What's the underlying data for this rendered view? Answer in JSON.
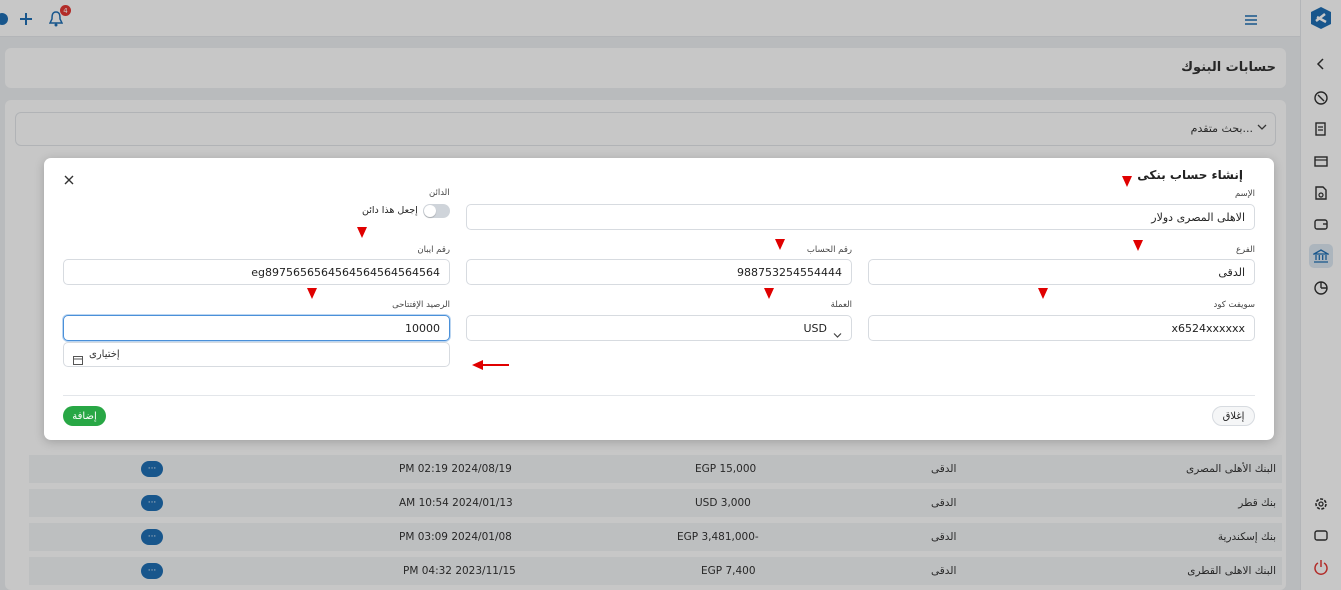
{
  "topbar": {
    "notification_count": "4"
  },
  "page": {
    "title": "حسابات البنوك"
  },
  "advanced_search": {
    "label": "بحث متقدم..."
  },
  "table": {
    "rows": [
      {
        "bank": "البنك الأهلى المصرى",
        "branch": "الدقى",
        "balance": "EGP 15,000",
        "date": "PM 02:19 2024/08/19",
        "action": "···"
      },
      {
        "bank": "بنك قطر",
        "branch": "الدقى",
        "balance": "USD 3,000",
        "date": "AM 10:54 2024/01/13",
        "action": "···"
      },
      {
        "bank": "بنك إسكندرية",
        "branch": "الدقى",
        "balance": "EGP 3,481,000-",
        "date": "PM 03:09 2024/01/08",
        "action": "···"
      },
      {
        "bank": "البنك الاهلى القطرى",
        "branch": "الدقى",
        "balance": "EGP 7,400",
        "date": "PM 04:32 2023/11/15",
        "action": "···"
      }
    ]
  },
  "modal": {
    "title": "إنشاء حساب بنكى",
    "name_label": "الإسم",
    "name_value": "الاهلى المصرى دولار",
    "creditor_label": "الدائن",
    "toggle_label": "إجعل هذا دائن",
    "branch_label": "الفرع",
    "branch_value": "الدقى",
    "account_label": "رقم الحساب",
    "account_value": "988753254554444",
    "iban_label": "رقم ايبان",
    "iban_value": "eg8975656564564564564564564",
    "swift_label": "سويفت كود",
    "swift_value": "x6524xxxxxx",
    "currency_label": "العملة",
    "currency_value": "USD",
    "opening_label": "الرصيد الإفتتاحى",
    "opening_value": "10000",
    "optional_label": "إختيارى",
    "close_button": "إغلاق",
    "add_button": "إضافة"
  },
  "colors": {
    "accent": "#1f6fb4",
    "success": "#28a745",
    "annotation": "#e00000"
  }
}
